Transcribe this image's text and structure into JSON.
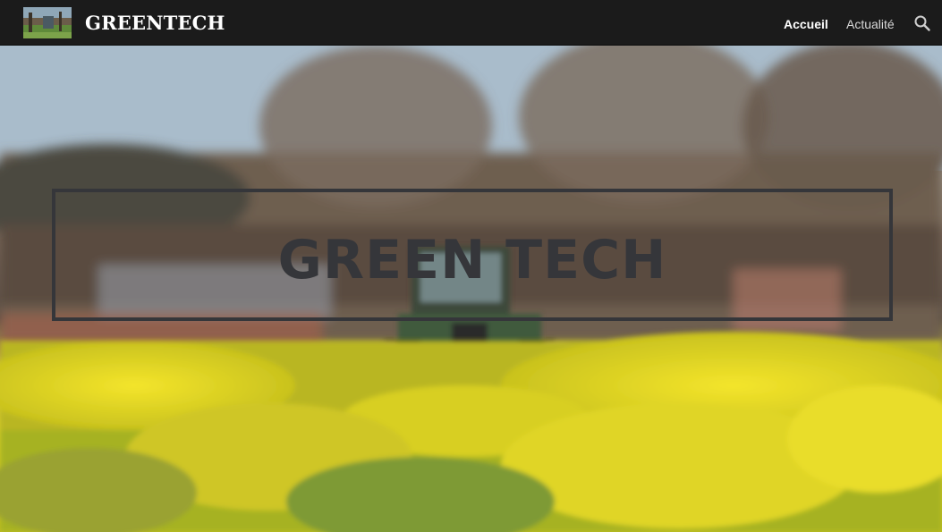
{
  "header": {
    "site_title": "GREENTECH",
    "logo_icon": "farm-field-thumbnail-icon",
    "nav": [
      {
        "label": "Accueil",
        "active": true
      },
      {
        "label": "Actualité",
        "active": false
      }
    ],
    "search_icon": "search-icon"
  },
  "hero": {
    "title": "GREEN TECH",
    "background": "tractor-in-rapeseed-field"
  },
  "colors": {
    "navbar_bg": "#1b1b1b",
    "nav_text": "#ffffff",
    "hero_title": "#35363a",
    "hero_frame": "#35363a"
  }
}
